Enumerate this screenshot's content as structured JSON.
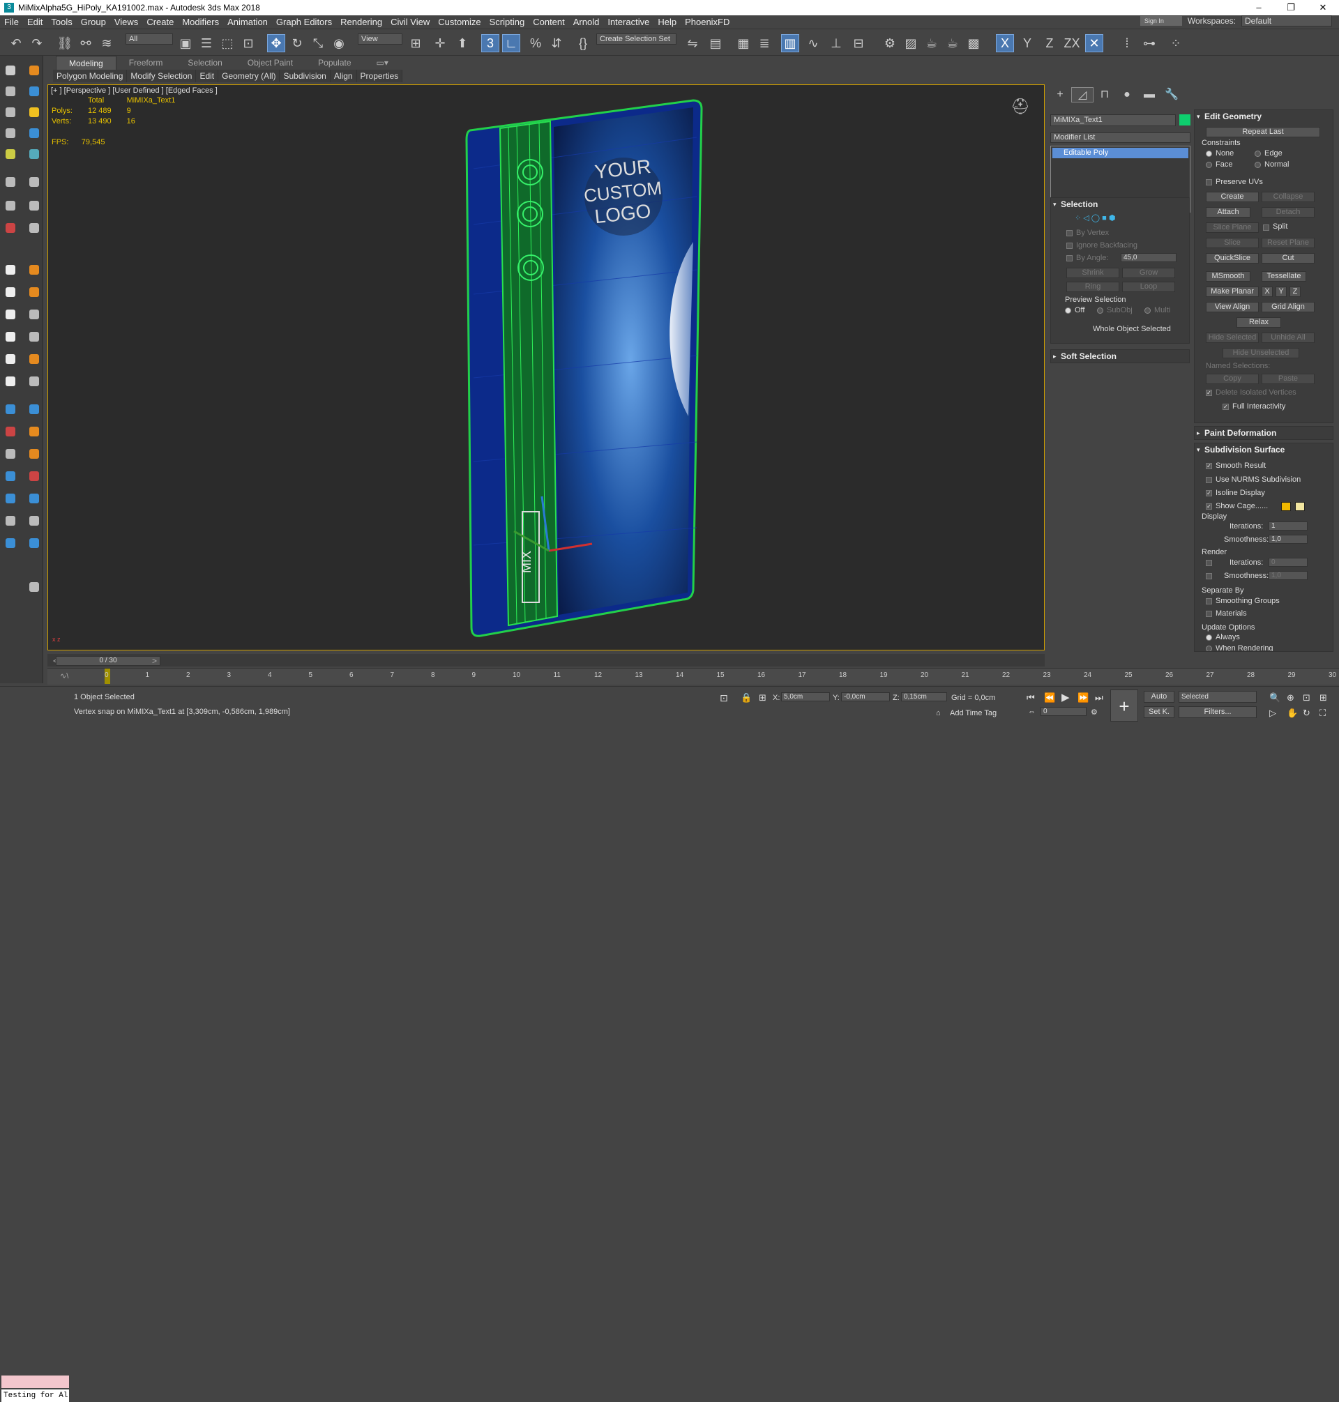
{
  "titlebar": {
    "title": "MiMixAlpha5G_HiPoly_KA191002.max - Autodesk 3ds Max 2018",
    "min": "–",
    "max": "❐",
    "close": "✕"
  },
  "menu": [
    "File",
    "Edit",
    "Tools",
    "Group",
    "Views",
    "Create",
    "Modifiers",
    "Animation",
    "Graph Editors",
    "Rendering",
    "Civil View",
    "Customize",
    "Scripting",
    "Content",
    "Arnold",
    "Interactive",
    "Help",
    "PhoenixFD"
  ],
  "menubar_right": {
    "signin": "Sign In",
    "workspaces_label": "Workspaces:",
    "workspace": "Default"
  },
  "toolbar": {
    "filter": "All",
    "refcoord": "View",
    "selset": "Create Selection Set",
    "axes": [
      "X",
      "Y",
      "Z",
      "ZX"
    ]
  },
  "ribbon": {
    "tabs": [
      "Modeling",
      "Freeform",
      "Selection",
      "Object Paint",
      "Populate"
    ],
    "sub": [
      "Polygon Modeling",
      "Modify Selection",
      "Edit",
      "Geometry (All)",
      "Subdivision",
      "Align",
      "Properties"
    ]
  },
  "viewport": {
    "label": "[+ ] [Perspective ] [User Defined ] [Edged Faces ]",
    "stats": {
      "h_total": "Total",
      "h_obj": "MiMIXa_Text1",
      "polys_label": "Polys:",
      "polys_total": "12 489",
      "polys_obj": "9",
      "verts_label": "Verts:",
      "verts_total": "13 490",
      "verts_obj": "16"
    },
    "fps_label": "FPS:",
    "fps": "79,545",
    "logo": [
      "YOUR",
      "CUSTOM",
      "LOGO"
    ],
    "mix_text": "MIX",
    "axis": "x z"
  },
  "cmd": {
    "object_name": "MiMIXa_Text1",
    "object_color": "#0ecf6e",
    "modifier_list": "Modifier List",
    "stack": [
      "Editable Poly"
    ]
  },
  "selection": {
    "title": "Selection",
    "by_vertex": "By Vertex",
    "ignore_backfacing": "Ignore Backfacing",
    "by_angle": "By Angle:",
    "angle": "45,0",
    "shrink": "Shrink",
    "grow": "Grow",
    "ring": "Ring",
    "loop": "Loop",
    "preview": "Preview Selection",
    "off": "Off",
    "subobj": "SubObj",
    "multi": "Multi",
    "status": "Whole Object Selected"
  },
  "soft": {
    "title": "Soft Selection"
  },
  "editgeo": {
    "title": "Edit Geometry",
    "repeat": "Repeat Last",
    "constraints": "Constraints",
    "none": "None",
    "edge": "Edge",
    "face": "Face",
    "normal": "Normal",
    "preserve": "Preserve UVs",
    "create": "Create",
    "collapse": "Collapse",
    "attach": "Attach",
    "detach": "Detach",
    "slice_plane": "Slice Plane",
    "split": "Split",
    "slice": "Slice",
    "reset_plane": "Reset Plane",
    "quickslice": "QuickSlice",
    "cut": "Cut",
    "msmooth": "MSmooth",
    "tessellate": "Tessellate",
    "make_planar": "Make Planar",
    "x": "X",
    "y": "Y",
    "z": "Z",
    "view_align": "View Align",
    "grid_align": "Grid Align",
    "relax": "Relax",
    "hide_sel": "Hide Selected",
    "unhide_all": "Unhide All",
    "hide_unsel": "Hide Unselected",
    "named": "Named Selections:",
    "copy": "Copy",
    "paste": "Paste",
    "delete_iso": "Delete Isolated Vertices",
    "full_inter": "Full Interactivity"
  },
  "paintdef": {
    "title": "Paint Deformation"
  },
  "subdiv": {
    "title": "Subdivision Surface",
    "smooth": "Smooth Result",
    "nurms": "Use NURMS Subdivision",
    "isoline": "Isoline Display",
    "cage": "Show Cage......",
    "cage_color1": "#f0b800",
    "cage_color2": "#f2e6a0",
    "display": "Display",
    "iter_label": "Iterations:",
    "iter": "1",
    "smooth_label": "Smoothness:",
    "smoothness": "1,0",
    "render": "Render",
    "r_iter": "0",
    "r_smooth": "1,0",
    "separate": "Separate By",
    "sgroups": "Smoothing Groups",
    "materials": "Materials",
    "update": "Update Options",
    "always": "Always",
    "when_render": "When Rendering"
  },
  "timeline": {
    "frame": "0 / 30",
    "ticks": [
      "0",
      "1",
      "2",
      "3",
      "4",
      "5",
      "6",
      "7",
      "8",
      "9",
      "10",
      "11",
      "12",
      "13",
      "14",
      "15",
      "16",
      "17",
      "18",
      "19",
      "20",
      "21",
      "22",
      "23",
      "24",
      "25",
      "26",
      "27",
      "28",
      "29",
      "30"
    ]
  },
  "status": {
    "script_text": "Testing for Al",
    "selected": "1 Object Selected",
    "prompt": "Vertex snap on MiMIXa_Text1 at [3,309cm, -0,586cm, 1,989cm]",
    "x_label": "X:",
    "x": "5,0cm",
    "y_label": "Y:",
    "y": "-0,0cm",
    "z_label": "Z:",
    "z": "0,15cm",
    "grid": "Grid = 0,0cm",
    "add_tag": "Add Time Tag",
    "auto": "Auto",
    "set_key": "Set K.",
    "sel_mode": "Selected",
    "filters": "Filters...",
    "frame_field": "0"
  }
}
